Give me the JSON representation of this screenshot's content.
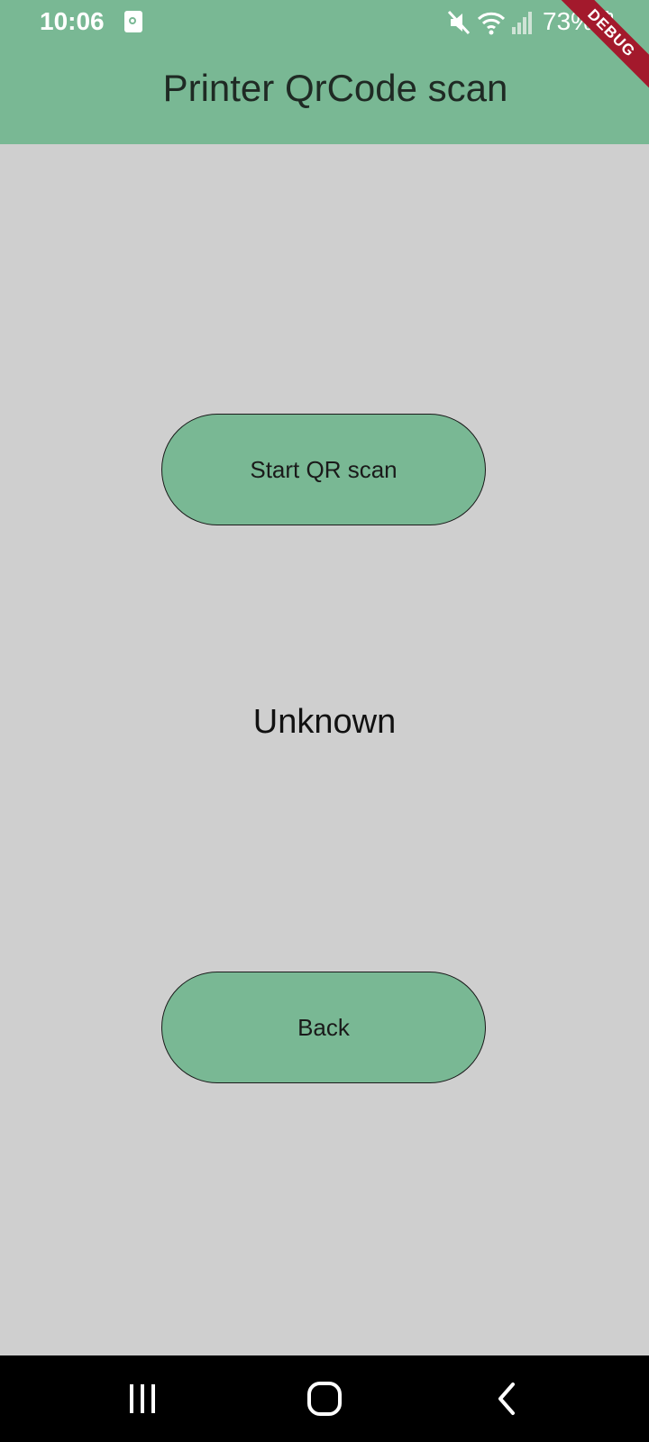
{
  "status_bar": {
    "time": "10:06",
    "battery": "73%",
    "icons": [
      "notification-icon",
      "mute-icon",
      "wifi-icon",
      "signal-icon",
      "battery-icon"
    ]
  },
  "debug_banner": "DEBUG",
  "app_bar": {
    "title": "Printer QrCode scan"
  },
  "main": {
    "start_button_label": "Start QR scan",
    "result_text": "Unknown",
    "back_button_label": "Back"
  },
  "nav_bar": {
    "buttons": [
      "recents-icon",
      "home-icon",
      "back-icon"
    ]
  },
  "colors": {
    "accent": "#79b894",
    "background": "#cfcfcf",
    "debug_ribbon": "#a3192c"
  }
}
